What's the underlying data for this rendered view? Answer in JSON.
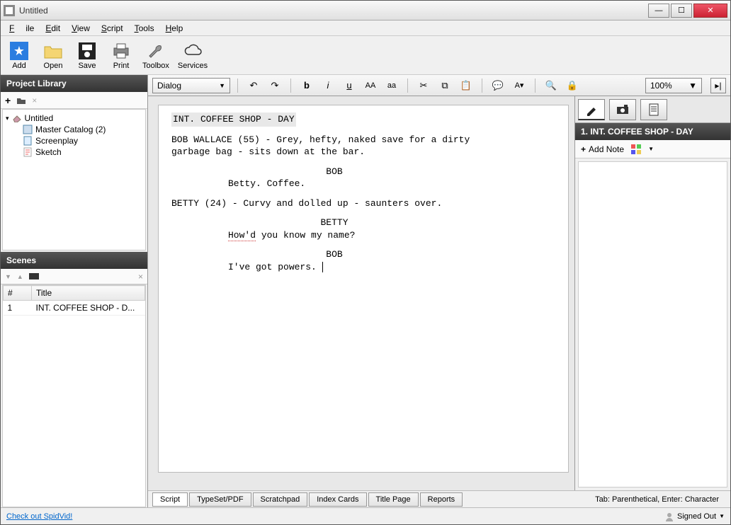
{
  "window": {
    "title": "Untitled"
  },
  "menu": {
    "file": "File",
    "edit": "Edit",
    "view": "View",
    "script": "Script",
    "tools": "Tools",
    "help": "Help"
  },
  "toolbar": {
    "add": "Add",
    "open": "Open",
    "save": "Save",
    "print": "Print",
    "toolbox": "Toolbox",
    "services": "Services"
  },
  "leftPanels": {
    "libraryTitle": "Project Library",
    "scenesTitle": "Scenes"
  },
  "tree": {
    "root": "Untitled",
    "items": [
      {
        "label": "Master Catalog (2)"
      },
      {
        "label": "Screenplay"
      },
      {
        "label": "Sketch"
      }
    ]
  },
  "sceneTable": {
    "cols": {
      "num": "#",
      "title": "Title"
    },
    "rows": [
      {
        "num": "1",
        "title": "INT. COFFEE SHOP - D..."
      }
    ]
  },
  "editor": {
    "elementType": "Dialog",
    "zoom": "100%",
    "content": {
      "slug": "INT. COFFEE SHOP - DAY",
      "action1a": "BOB WALLACE (55) - Grey, hefty, naked save for a dirty",
      "action1b": "garbage bag - sits down at the bar.",
      "char1": "BOB",
      "dlg1": "Betty.  Coffee.",
      "action2": "BETTY (24) - Curvy and dolled up - saunters over.",
      "char2": "BETTY",
      "dlg2": "How'd you know my name?",
      "char3": "BOB",
      "dlg3": "I've got powers."
    }
  },
  "rightPanel": {
    "sceneHead": "1. INT. COFFEE SHOP - DAY",
    "addNote": "Add Note"
  },
  "bottomTabs": {
    "script": "Script",
    "typeset": "TypeSet/PDF",
    "scratch": "Scratchpad",
    "index": "Index Cards",
    "titlepage": "Title Page",
    "reports": "Reports",
    "hint": "Tab: Parenthetical, Enter: Character"
  },
  "status": {
    "link": "Check out SpidVid!",
    "signed": "Signed Out"
  }
}
